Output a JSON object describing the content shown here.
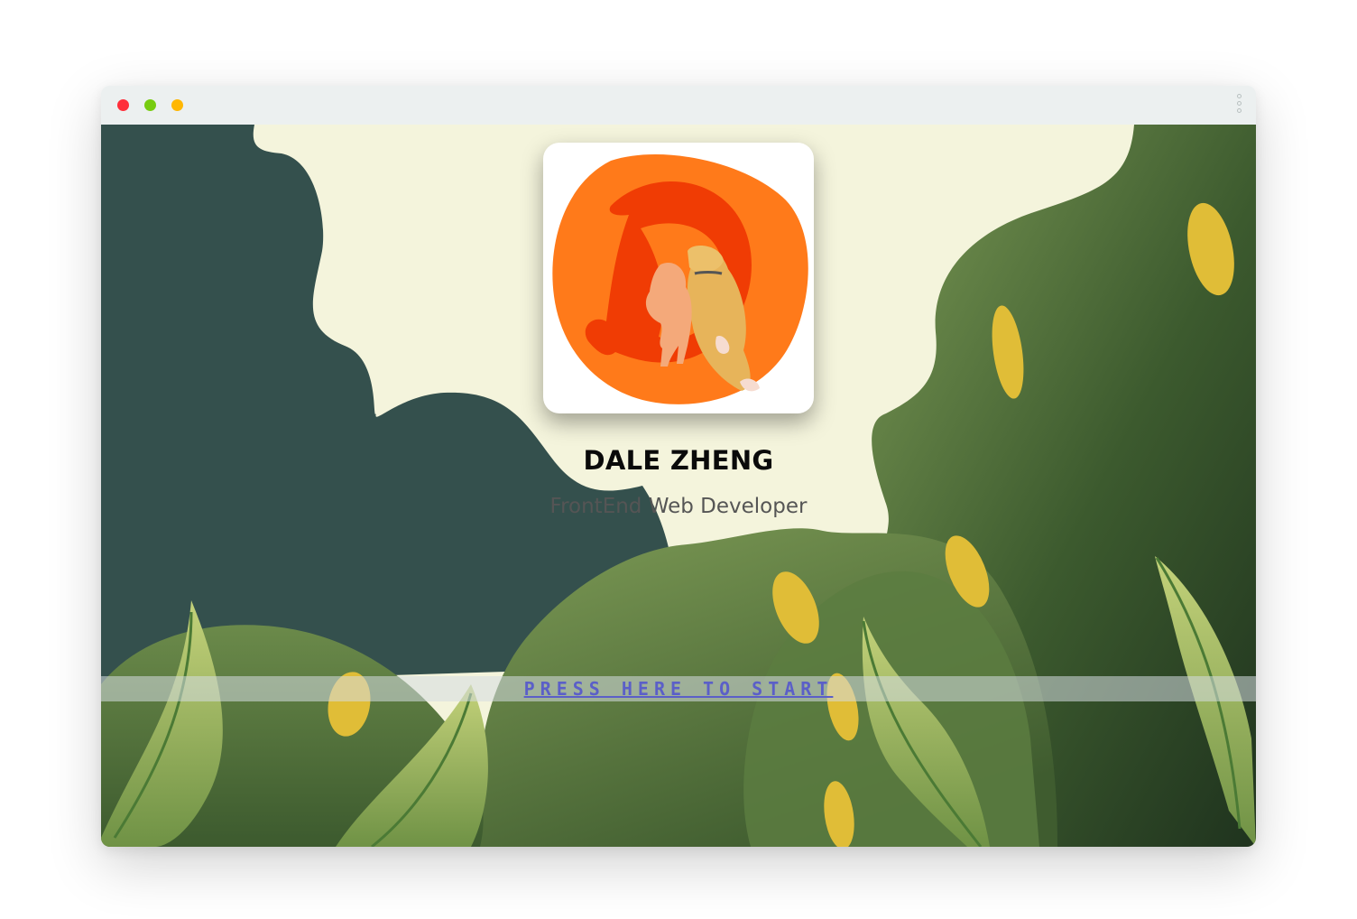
{
  "window": {
    "controls": [
      "close",
      "minimize",
      "maximize"
    ],
    "menu_icon": "kebab-menu-icon"
  },
  "hero": {
    "logo_icon": "dog-logo-icon",
    "name": "DALE ZHENG",
    "role": "FrontEnd Web Developer",
    "start_link": "PRESS HERE TO START"
  },
  "colors": {
    "cream": "#f4f4dc",
    "dark_teal": "#34504d",
    "leaf_green": "#6f8f4e",
    "deep_green": "#213720",
    "petal_yellow": "#e0bd37",
    "logo_orange": "#ff7a1a",
    "logo_red": "#f03c04",
    "link_blue": "#5b5fc8"
  }
}
